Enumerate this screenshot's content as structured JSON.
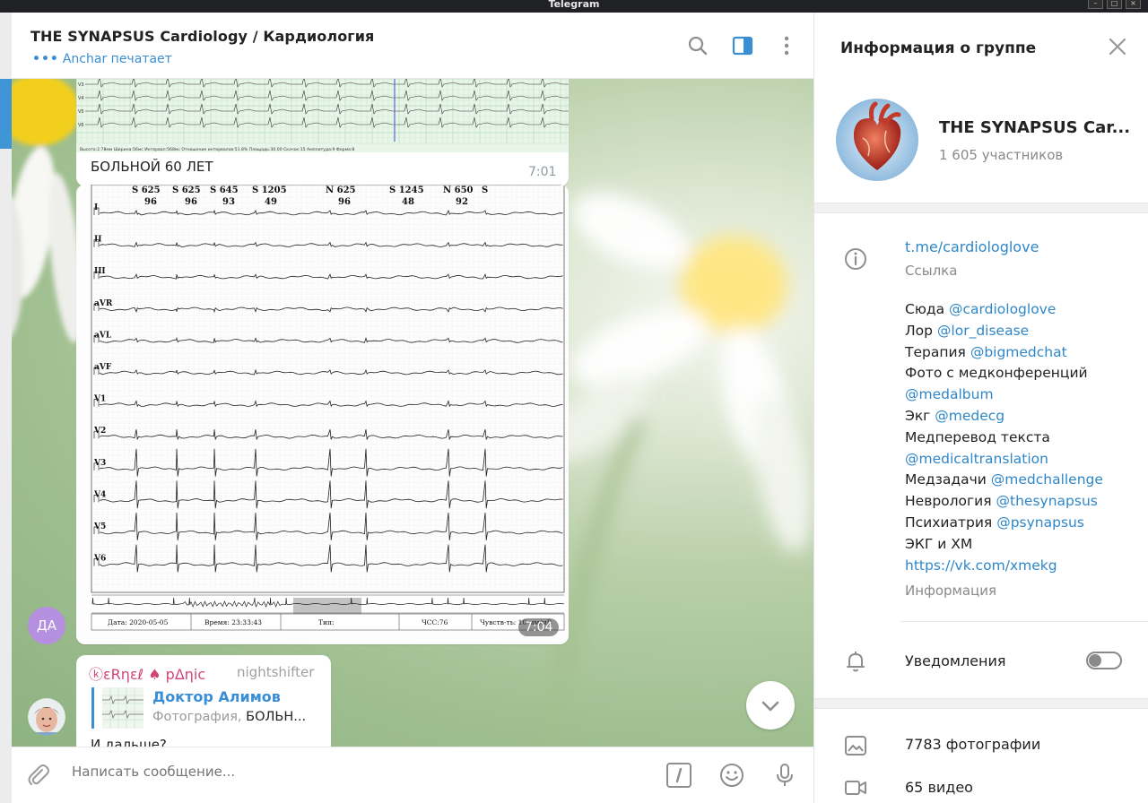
{
  "window": {
    "title": "Telegram"
  },
  "chat": {
    "title": "THE SYNAPSUS Cardiology / Кардиология",
    "typing": "Anchar печатает",
    "composer_placeholder": "Написать сообщение..."
  },
  "messages": [
    {
      "caption": "БОЛЬНОЙ 60 ЛЕТ",
      "time": "7:01"
    },
    {
      "time": "7:04",
      "sender_avatar": "ДА"
    },
    {
      "author": "ⓚεRηεℓ ♠ pΔηic",
      "author_tag": "nightshifter",
      "reply_to": "Доктор Алимов",
      "reply_type": "Фотография,",
      "reply_text": "БОЛЬН...",
      "text": "И дальше?"
    }
  ],
  "ecg_top": {
    "lead_labels": [
      "V3",
      "V4",
      "V5",
      "V6"
    ],
    "footer": "Высота:2.78мм  Ширина:56мс  Интервал:568мс  Отношение интервалов:51.8%  Площадь:30.00  Скачок:15  Амплитуда:9  Форма:8"
  },
  "ecg_main": {
    "header_marks": [
      {
        "type": "S",
        "rr": "625",
        "hr": "96"
      },
      {
        "type": "S",
        "rr": "625",
        "hr": "96"
      },
      {
        "type": "S",
        "rr": "645",
        "hr": "93"
      },
      {
        "type": "S",
        "rr": "1205",
        "hr": "49"
      },
      {
        "type": "N",
        "rr": "625",
        "hr": "96"
      },
      {
        "type": "S",
        "rr": "1245",
        "hr": "48"
      },
      {
        "type": "N",
        "rr": "650",
        "hr": "92"
      },
      {
        "type": "S",
        "rr": "",
        "hr": ""
      }
    ],
    "leads": [
      "I",
      "II",
      "III",
      "aVR",
      "aVL",
      "aVF",
      "V1",
      "V2",
      "V3",
      "V4",
      "V5",
      "V6"
    ],
    "footer": {
      "date": "Дата: 2020-05-05",
      "time": "Время: 23:33:43",
      "type": "Тип:",
      "hr": "ЧСС:76",
      "sens": "Чувств-ть: 10 мм/мВ"
    }
  },
  "group_info": {
    "panel_title": "Информация о группе",
    "name": "THE SYNAPSUS Car...",
    "members": "1 605 участников",
    "link": "t.me/cardiologlove",
    "link_caption": "Ссылка",
    "description_caption": "Информация",
    "notifications_label": "Уведомления",
    "photos": "7783 фотографии",
    "videos": "65 видео",
    "description": [
      {
        "text": "Сюда ",
        "link": "@cardiologlove"
      },
      {
        "text": "Лор ",
        "link": "@lor_disease"
      },
      {
        "text": "Терапия ",
        "link": "@bigmedchat"
      },
      {
        "text": "Фото с медконференций",
        "link": ""
      },
      {
        "text": "",
        "link": "@medalbum"
      },
      {
        "text": "Экг ",
        "link": "@medecg"
      },
      {
        "text": "Медперевод текста",
        "link": ""
      },
      {
        "text": "",
        "link": "@medicaltranslation"
      },
      {
        "text": "Медзадачи ",
        "link": "@medchallenge"
      },
      {
        "text": "Неврология ",
        "link": "@thesynapsus"
      },
      {
        "text": "Психиатрия ",
        "link": "@psynapsus"
      },
      {
        "text": "ЭКГ и ХМ",
        "link": ""
      },
      {
        "text": "",
        "link": "https://vk.com/xmekg"
      }
    ]
  }
}
